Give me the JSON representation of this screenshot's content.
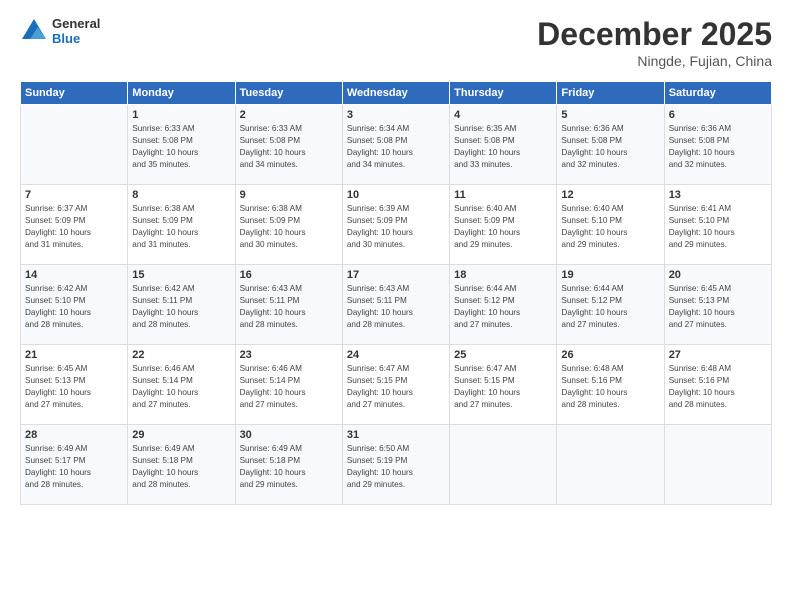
{
  "header": {
    "logo_line1": "General",
    "logo_line2": "Blue",
    "month": "December 2025",
    "location": "Ningde, Fujian, China"
  },
  "days_of_week": [
    "Sunday",
    "Monday",
    "Tuesday",
    "Wednesday",
    "Thursday",
    "Friday",
    "Saturday"
  ],
  "weeks": [
    [
      {
        "day": "",
        "content": ""
      },
      {
        "day": "1",
        "content": "Sunrise: 6:33 AM\nSunset: 5:08 PM\nDaylight: 10 hours\nand 35 minutes."
      },
      {
        "day": "2",
        "content": "Sunrise: 6:33 AM\nSunset: 5:08 PM\nDaylight: 10 hours\nand 34 minutes."
      },
      {
        "day": "3",
        "content": "Sunrise: 6:34 AM\nSunset: 5:08 PM\nDaylight: 10 hours\nand 34 minutes."
      },
      {
        "day": "4",
        "content": "Sunrise: 6:35 AM\nSunset: 5:08 PM\nDaylight: 10 hours\nand 33 minutes."
      },
      {
        "day": "5",
        "content": "Sunrise: 6:36 AM\nSunset: 5:08 PM\nDaylight: 10 hours\nand 32 minutes."
      },
      {
        "day": "6",
        "content": "Sunrise: 6:36 AM\nSunset: 5:08 PM\nDaylight: 10 hours\nand 32 minutes."
      }
    ],
    [
      {
        "day": "7",
        "content": "Sunrise: 6:37 AM\nSunset: 5:09 PM\nDaylight: 10 hours\nand 31 minutes."
      },
      {
        "day": "8",
        "content": "Sunrise: 6:38 AM\nSunset: 5:09 PM\nDaylight: 10 hours\nand 31 minutes."
      },
      {
        "day": "9",
        "content": "Sunrise: 6:38 AM\nSunset: 5:09 PM\nDaylight: 10 hours\nand 30 minutes."
      },
      {
        "day": "10",
        "content": "Sunrise: 6:39 AM\nSunset: 5:09 PM\nDaylight: 10 hours\nand 30 minutes."
      },
      {
        "day": "11",
        "content": "Sunrise: 6:40 AM\nSunset: 5:09 PM\nDaylight: 10 hours\nand 29 minutes."
      },
      {
        "day": "12",
        "content": "Sunrise: 6:40 AM\nSunset: 5:10 PM\nDaylight: 10 hours\nand 29 minutes."
      },
      {
        "day": "13",
        "content": "Sunrise: 6:41 AM\nSunset: 5:10 PM\nDaylight: 10 hours\nand 29 minutes."
      }
    ],
    [
      {
        "day": "14",
        "content": "Sunrise: 6:42 AM\nSunset: 5:10 PM\nDaylight: 10 hours\nand 28 minutes."
      },
      {
        "day": "15",
        "content": "Sunrise: 6:42 AM\nSunset: 5:11 PM\nDaylight: 10 hours\nand 28 minutes."
      },
      {
        "day": "16",
        "content": "Sunrise: 6:43 AM\nSunset: 5:11 PM\nDaylight: 10 hours\nand 28 minutes."
      },
      {
        "day": "17",
        "content": "Sunrise: 6:43 AM\nSunset: 5:11 PM\nDaylight: 10 hours\nand 28 minutes."
      },
      {
        "day": "18",
        "content": "Sunrise: 6:44 AM\nSunset: 5:12 PM\nDaylight: 10 hours\nand 27 minutes."
      },
      {
        "day": "19",
        "content": "Sunrise: 6:44 AM\nSunset: 5:12 PM\nDaylight: 10 hours\nand 27 minutes."
      },
      {
        "day": "20",
        "content": "Sunrise: 6:45 AM\nSunset: 5:13 PM\nDaylight: 10 hours\nand 27 minutes."
      }
    ],
    [
      {
        "day": "21",
        "content": "Sunrise: 6:45 AM\nSunset: 5:13 PM\nDaylight: 10 hours\nand 27 minutes."
      },
      {
        "day": "22",
        "content": "Sunrise: 6:46 AM\nSunset: 5:14 PM\nDaylight: 10 hours\nand 27 minutes."
      },
      {
        "day": "23",
        "content": "Sunrise: 6:46 AM\nSunset: 5:14 PM\nDaylight: 10 hours\nand 27 minutes."
      },
      {
        "day": "24",
        "content": "Sunrise: 6:47 AM\nSunset: 5:15 PM\nDaylight: 10 hours\nand 27 minutes."
      },
      {
        "day": "25",
        "content": "Sunrise: 6:47 AM\nSunset: 5:15 PM\nDaylight: 10 hours\nand 27 minutes."
      },
      {
        "day": "26",
        "content": "Sunrise: 6:48 AM\nSunset: 5:16 PM\nDaylight: 10 hours\nand 28 minutes."
      },
      {
        "day": "27",
        "content": "Sunrise: 6:48 AM\nSunset: 5:16 PM\nDaylight: 10 hours\nand 28 minutes."
      }
    ],
    [
      {
        "day": "28",
        "content": "Sunrise: 6:49 AM\nSunset: 5:17 PM\nDaylight: 10 hours\nand 28 minutes."
      },
      {
        "day": "29",
        "content": "Sunrise: 6:49 AM\nSunset: 5:18 PM\nDaylight: 10 hours\nand 28 minutes."
      },
      {
        "day": "30",
        "content": "Sunrise: 6:49 AM\nSunset: 5:18 PM\nDaylight: 10 hours\nand 29 minutes."
      },
      {
        "day": "31",
        "content": "Sunrise: 6:50 AM\nSunset: 5:19 PM\nDaylight: 10 hours\nand 29 minutes."
      },
      {
        "day": "",
        "content": ""
      },
      {
        "day": "",
        "content": ""
      },
      {
        "day": "",
        "content": ""
      }
    ]
  ]
}
